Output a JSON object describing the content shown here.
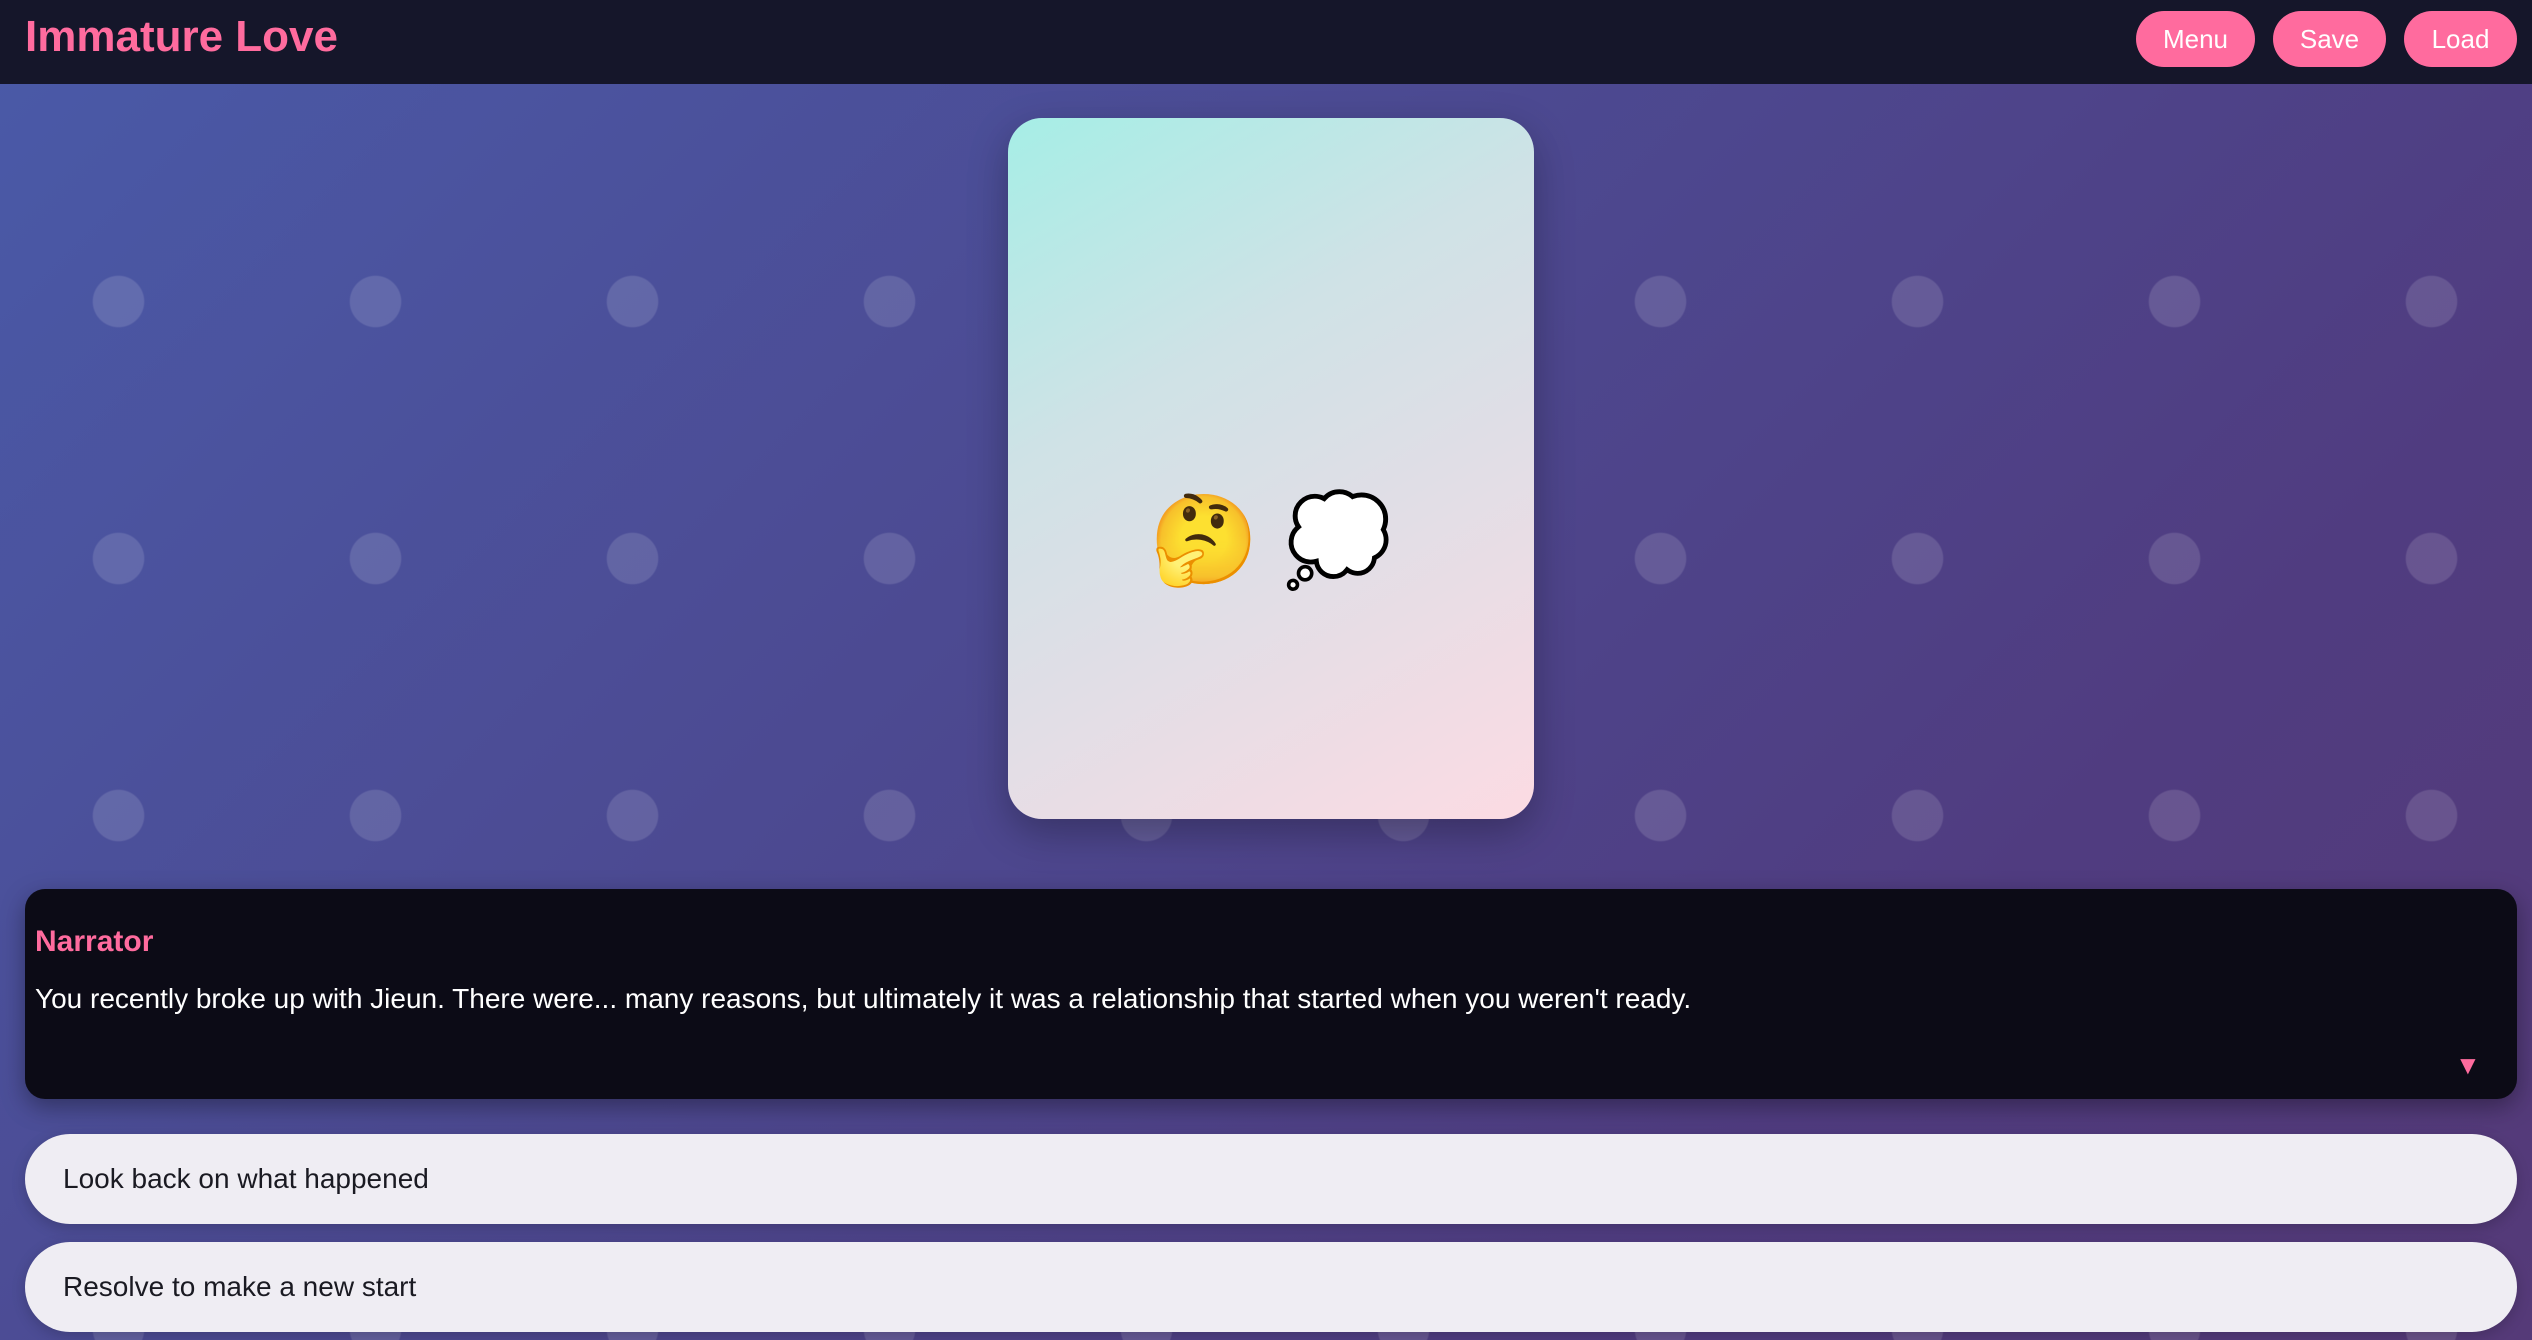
{
  "game": {
    "title": "Immature Love"
  },
  "top_buttons": {
    "menu": "Menu",
    "save": "Save",
    "load": "Load"
  },
  "portrait": {
    "emoji": "🤔 💭",
    "icons": [
      "thinking-face-icon",
      "thought-bubble-icon"
    ]
  },
  "dialogue": {
    "speaker": "Narrator",
    "text": "You recently broke up with Jieun. There were... many reasons, but ultimately it was a relationship that started when you weren't ready.",
    "advance_glyph": "▼"
  },
  "choices": [
    {
      "label": "Look back on what happened"
    },
    {
      "label": "Resolve to make a new start"
    }
  ],
  "colors": {
    "accent": "#ff6b9e",
    "topbar": "#15162a",
    "dialogue_bg": "#0c0b16",
    "choice_bg": "#efedf3"
  }
}
